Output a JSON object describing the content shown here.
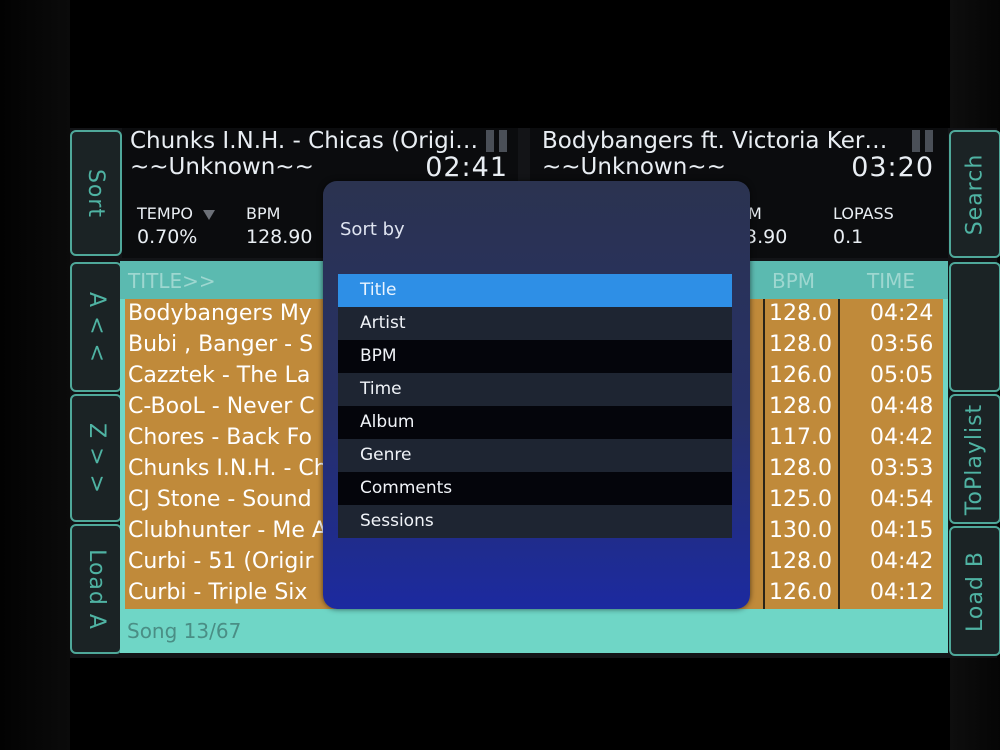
{
  "deck_a": {
    "title": "Chunks I.N.H. - Chicas (Origi…",
    "artist": "~~Unknown~~",
    "time": "02:41",
    "tempo_label": "TEMPO",
    "tempo_value": "0.70%",
    "bpm_label": "BPM",
    "bpm_value": "128.90"
  },
  "deck_b": {
    "title": "Bodybangers ft. Victoria Ker…",
    "artist": "~~Unknown~~",
    "time": "03:20",
    "bpm_label_partial": "M",
    "bpm_value_partial": "3.90",
    "lopass_label": "LOPASS",
    "lopass_value": "0.1"
  },
  "side_buttons": {
    "sort": "Sort",
    "az": "A < <",
    "za": "Z > >",
    "load_a": "Load A",
    "search": "Search",
    "to_playlist": "ToPlaylist",
    "load_b": "Load B"
  },
  "library": {
    "col_title": "TITLE>>",
    "col_bpm": "BPM",
    "col_time": "TIME",
    "rows": [
      {
        "title": "Bodybangers My",
        "bpm": "128.0",
        "time": "04:24"
      },
      {
        "title": "Bubi , Banger - S",
        "bpm": "128.0",
        "time": "03:56"
      },
      {
        "title": "Cazztek - The La",
        "bpm": "126.0",
        "time": "05:05"
      },
      {
        "title": "C-BooL - Never C",
        "bpm": "128.0",
        "time": "04:48"
      },
      {
        "title": "Chores - Back Fo",
        "bpm": "117.0",
        "time": "04:42"
      },
      {
        "title": "Chunks I.N.H. - Ch",
        "bpm": "128.0",
        "time": "03:53"
      },
      {
        "title": "CJ Stone - Sound",
        "bpm": "125.0",
        "time": "04:54"
      },
      {
        "title": "Clubhunter - Me A",
        "bpm": "130.0",
        "time": "04:15"
      },
      {
        "title": "Curbi - 51 (Origir",
        "bpm": "128.0",
        "time": "04:42"
      },
      {
        "title": "Curbi - Triple Six",
        "bpm": "126.0",
        "time": "04:12"
      }
    ],
    "status": "Song 13/67"
  },
  "sort_dialog": {
    "title": "Sort by",
    "options": [
      "Title",
      "Artist",
      "BPM",
      "Time",
      "Album",
      "Genre",
      "Comments",
      "Sessions"
    ],
    "selected": "Title"
  }
}
